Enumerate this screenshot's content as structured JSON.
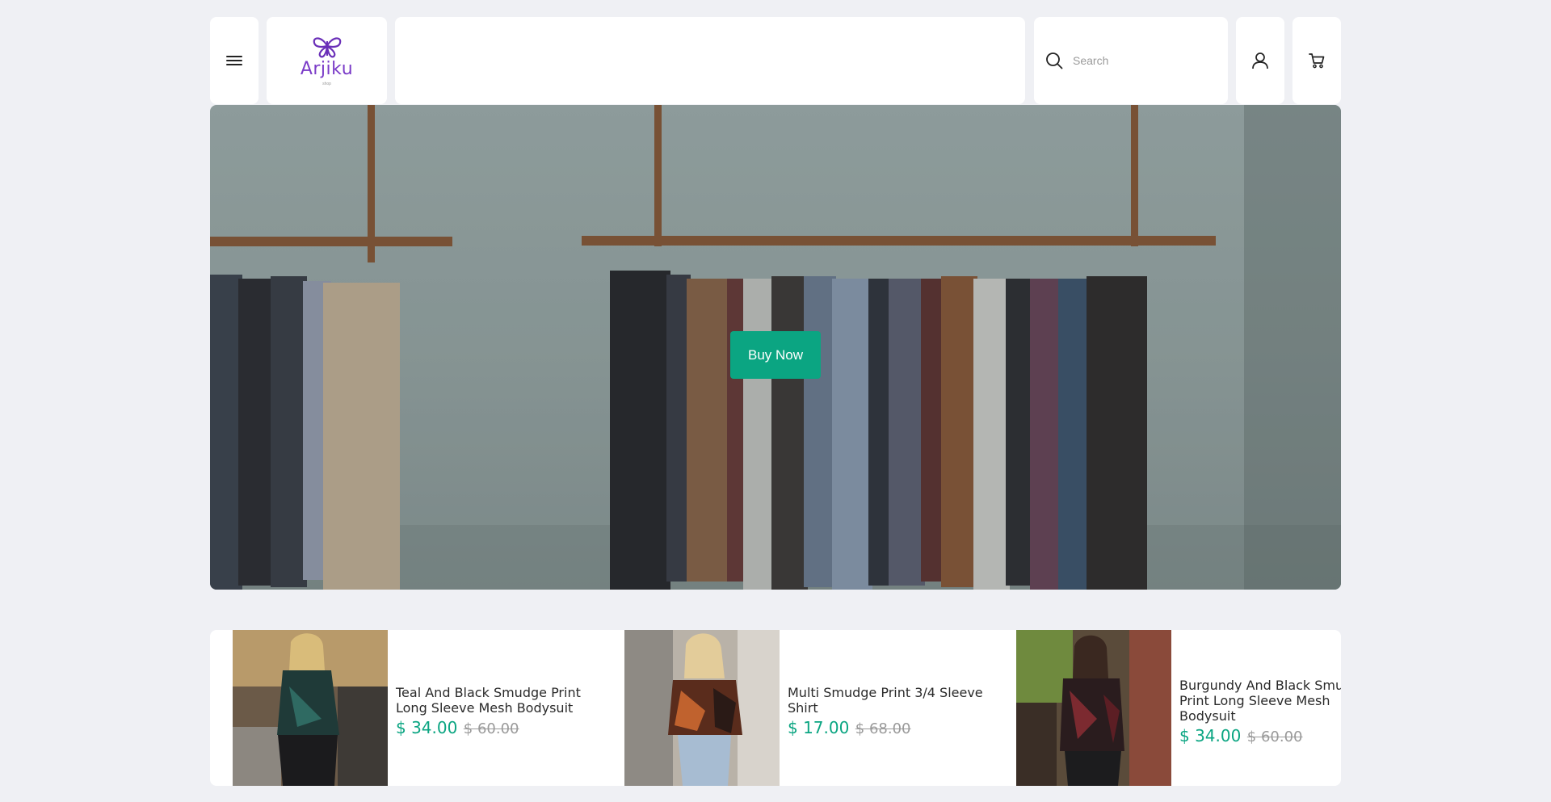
{
  "header": {
    "logo_name": "Arjiku",
    "logo_sub": "shop",
    "search_placeholder": "Search",
    "icons": {
      "menu": "hamburger-menu-icon",
      "logo": "butterfly-icon",
      "search": "search-icon",
      "account": "user-icon",
      "cart": "cart-icon"
    }
  },
  "hero": {
    "button_label": "Buy Now",
    "image": "clothing-rack"
  },
  "products": [
    {
      "name": "Teal And Black Smudge Print Long Sleeve Mesh Bodysuit",
      "price": "$ 34.00",
      "old_price": "$ 60.00",
      "image": "teal-black-mesh-top"
    },
    {
      "name": "Multi Smudge Print 3/4 Sleeve Shirt",
      "price": "$ 17.00",
      "old_price": "$ 68.00",
      "image": "multi-smudge-shirt"
    },
    {
      "name": "Burgundy And Black Smudge Print Long Sleeve Mesh Bodysuit",
      "price": "$ 34.00",
      "old_price": "$ 60.00",
      "image": "burgundy-black-mesh-top"
    }
  ],
  "colors": {
    "accent": "#0ba582",
    "brand": "#7b3cc8",
    "background": "#eff0f4"
  }
}
